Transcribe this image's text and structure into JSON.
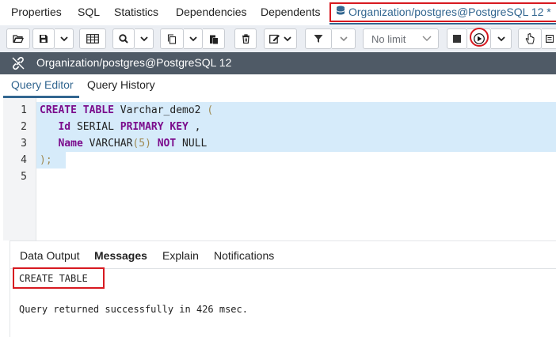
{
  "top_tabs": {
    "properties": "Properties",
    "sql": "SQL",
    "statistics": "Statistics",
    "dependencies": "Dependencies",
    "dependents": "Dependents",
    "query_tool": "Organization/postgres@PostgreSQL 12 *"
  },
  "toolbar": {
    "limit_select": {
      "selected": "No limit"
    },
    "icons": [
      "open-file-icon",
      "save-icon",
      "chevron-down-icon",
      "grid-icon",
      "search-icon",
      "chevron-down-icon",
      "copy-icon",
      "chevron-down-icon",
      "paste-icon",
      "delete-icon",
      "edit-icon",
      "chevron-down-icon",
      "filter-icon",
      "chevron-down-icon",
      "stop-icon",
      "execute-icon",
      "chevron-down-icon",
      "pointer-icon",
      "more-icon"
    ]
  },
  "connection": {
    "label": "Organization/postgres@PostgreSQL 12"
  },
  "editor_tabs": {
    "query_editor": "Query Editor",
    "query_history": "Query History"
  },
  "editor": {
    "line_numbers": [
      "1",
      "2",
      "3",
      "4",
      "5"
    ],
    "lines": [
      [
        {
          "t": "CREATE TABLE",
          "c": "kw"
        },
        {
          "t": " Varchar_demo2 ",
          "c": "id"
        },
        {
          "t": "(",
          "c": "pn"
        }
      ],
      [
        {
          "t": "   ",
          "c": "id"
        },
        {
          "t": "Id",
          "c": "kw"
        },
        {
          "t": " SERIAL ",
          "c": "ty"
        },
        {
          "t": "PRIMARY KEY",
          "c": "kw"
        },
        {
          "t": " ,",
          "c": "id"
        }
      ],
      [
        {
          "t": "   ",
          "c": "id"
        },
        {
          "t": "Name",
          "c": "kw"
        },
        {
          "t": " VARCHAR",
          "c": "ty"
        },
        {
          "t": "(",
          "c": "pn"
        },
        {
          "t": "5",
          "c": "pn"
        },
        {
          "t": ")",
          "c": "pn"
        },
        {
          "t": " ",
          "c": "id"
        },
        {
          "t": "NOT",
          "c": "kw"
        },
        {
          "t": " NULL",
          "c": "ty"
        }
      ],
      [
        {
          "t": ");",
          "c": "pn"
        }
      ],
      []
    ]
  },
  "results": {
    "tabs": {
      "data_output": "Data Output",
      "messages": "Messages",
      "explain": "Explain",
      "notifications": "Notifications"
    },
    "messages": {
      "line1": "CREATE TABLE",
      "line2": "Query returned successfully in 426 msec."
    }
  },
  "colors": {
    "accent": "#326690",
    "highlight_border": "#d71920",
    "connection_bar": "#4f5a66",
    "selection": "#d6ebfa",
    "keyword": "#7b0c8c"
  }
}
